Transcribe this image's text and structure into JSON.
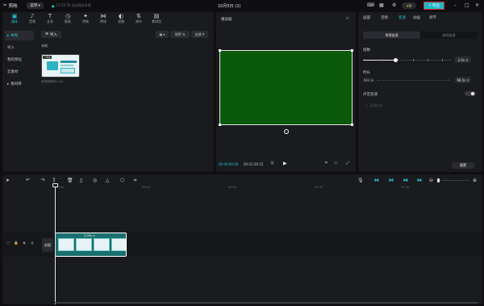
{
  "app": {
    "logo_text": "剪映",
    "menu_label": "菜单",
    "autosave_text": "12:52:35 自动保存本地",
    "project_title": "10月5日 (2)",
    "export_label": "导出",
    "badge_text": "VIP",
    "accent_color": "#22c6d6",
    "export_border_color": "#e02b2b"
  },
  "media_toolbar": [
    {
      "label": "媒体",
      "icon": "media-icon",
      "glyph": "▣",
      "active": true
    },
    {
      "label": "音频",
      "icon": "audio-icon",
      "glyph": "♪",
      "active": false
    },
    {
      "label": "文本",
      "icon": "text-icon",
      "glyph": "T",
      "active": false
    },
    {
      "label": "贴纸",
      "icon": "sticker-icon",
      "glyph": "◷",
      "active": false
    },
    {
      "label": "特效",
      "icon": "effects-icon",
      "glyph": "✦",
      "active": false
    },
    {
      "label": "转场",
      "icon": "transition-icon",
      "glyph": "⋈",
      "active": false
    },
    {
      "label": "滤镜",
      "icon": "filter-icon",
      "glyph": "◐",
      "active": false
    },
    {
      "label": "调节",
      "icon": "adjust-icon",
      "glyph": "⇅",
      "active": false
    },
    {
      "label": "素材包",
      "icon": "package-icon",
      "glyph": "▤",
      "active": false
    }
  ],
  "media_sidebar": [
    {
      "label": "本地",
      "active": true
    },
    {
      "label": "导入",
      "active": false
    },
    {
      "label": "我的预设",
      "active": false
    },
    {
      "label": "云素材",
      "active": false
    },
    {
      "label": "素材库",
      "active": false
    }
  ],
  "media_panel": {
    "import_label": "导入",
    "sort_label": "排序",
    "filter_label": "全部",
    "section_label": "本地",
    "thumb_badge": "已添加",
    "file_name": "视频编辑器.mp4"
  },
  "player": {
    "title": "播放器",
    "current_time": "00:00:00:00",
    "total_time": "00:01:36:15",
    "preview_color": "#0b5a0b"
  },
  "inspector": {
    "tabs": [
      {
        "label": "画面",
        "active": false
      },
      {
        "label": "音频",
        "active": false
      },
      {
        "label": "变速",
        "active": true
      },
      {
        "label": "动画",
        "active": false
      },
      {
        "label": "调节",
        "active": false
      }
    ],
    "subtabs": [
      {
        "label": "常规变速",
        "active": true
      },
      {
        "label": "曲线变速",
        "active": false
      }
    ],
    "speed_label": "倍数",
    "speed_value": "2.0x",
    "duration_label": "时长",
    "duration_from": "193.1s",
    "duration_value": "96.5s",
    "pitch_label": "声音变调",
    "smart_label": "智能补帧",
    "reset_label": "重置"
  },
  "timeline": {
    "ruler_labels": [
      "00:00",
      "00:10",
      "00:20",
      "00:30",
      "00:40"
    ],
    "cover_label": "封面",
    "clip_speed": "2.00x"
  }
}
